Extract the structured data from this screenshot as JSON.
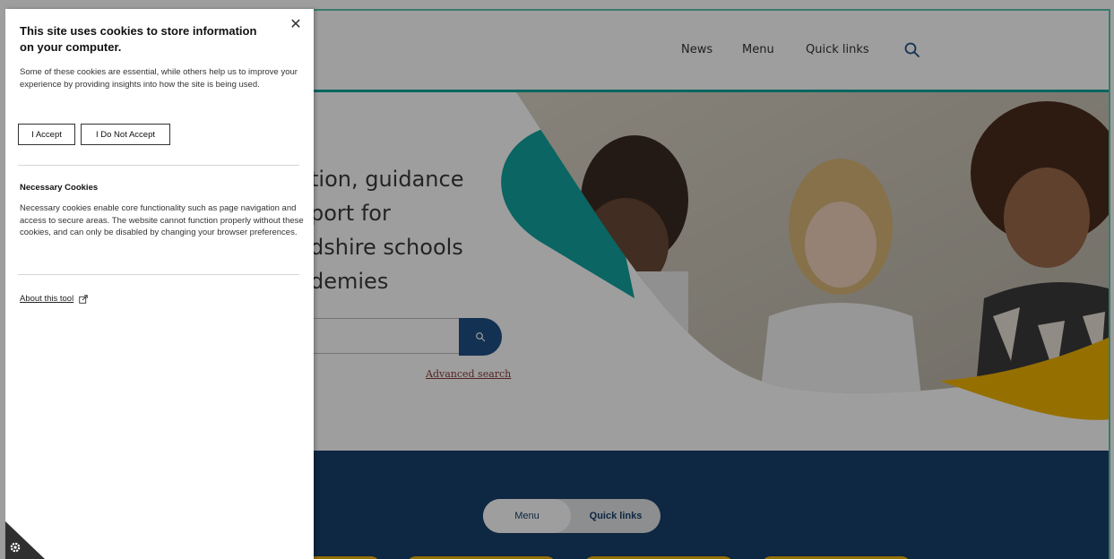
{
  "cookie_panel": {
    "title": "This site uses cookies to store information on your computer.",
    "intro": "Some of these cookies are essential, while others help us to improve your experience by providing insights into how the site is being used.",
    "accept_label": "I Accept",
    "decline_label": "I Do Not Accept",
    "necessary_title": "Necessary Cookies",
    "necessary_text": "Necessary cookies enable core functionality such as page navigation and access to secure areas. The website cannot function properly without these cookies, and can only be disabled by changing your browser preferences.",
    "about_label": "About this tool",
    "close_icon": "close-icon",
    "settings_icon": "gear-icon"
  },
  "header": {
    "nav": [
      "News",
      "Menu",
      "Quick links"
    ],
    "search_icon": "search-icon"
  },
  "hero": {
    "title_lines": [
      "tion, guidance",
      "port for",
      "dshire schools",
      "demies"
    ],
    "advanced_search_label": "Advanced search"
  },
  "section": {
    "toggle": [
      "Menu",
      "Quick links"
    ]
  },
  "colors": {
    "accent_teal": "#10a59a",
    "navy": "#173f6b",
    "search_button": "#1f4f86",
    "yellow": "#f0b400"
  }
}
